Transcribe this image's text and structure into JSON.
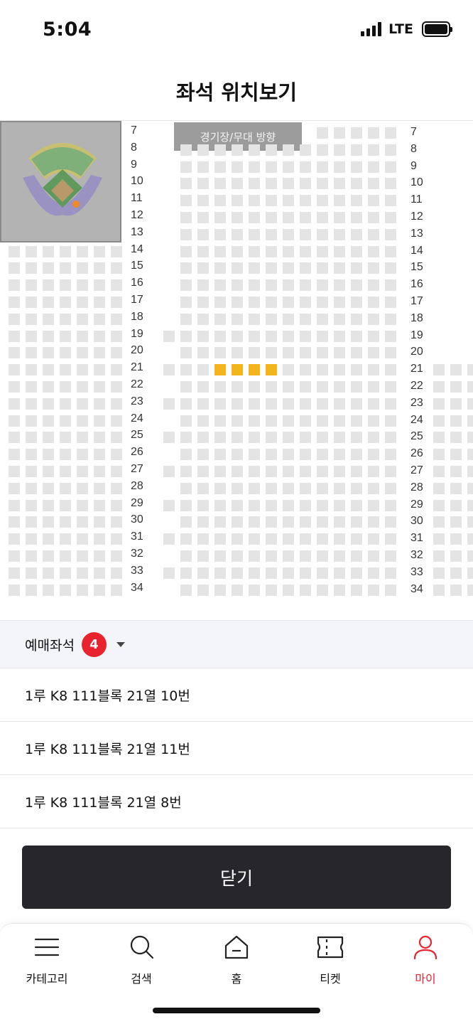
{
  "status_bar": {
    "time": "5:04",
    "network": "LTE",
    "battery_level": 1.0
  },
  "header": {
    "title": "좌석 위치보기"
  },
  "seat_map": {
    "direction_label": "경기장/무대 방향",
    "rows_left": [
      "7",
      "8",
      "9",
      "10",
      "11",
      "12",
      "13",
      "14",
      "15",
      "16",
      "17",
      "18",
      "19",
      "20",
      "21",
      "22",
      "23",
      "24",
      "25",
      "26",
      "27",
      "28",
      "29",
      "30",
      "31",
      "32",
      "33",
      "34"
    ],
    "rows_right": [
      "7",
      "8",
      "9",
      "10",
      "11",
      "12",
      "13",
      "14",
      "15",
      "16",
      "17",
      "18",
      "19",
      "20",
      "21",
      "22",
      "23",
      "24",
      "25",
      "26",
      "27",
      "28",
      "29",
      "30",
      "31",
      "32",
      "33",
      "34"
    ],
    "selected_row": "21",
    "seat_available_color": "#e4e4e4",
    "seat_selected_color": "#f3b51c",
    "minimap_icon": "stadium-minimap-icon"
  },
  "booked_seats": {
    "title": "예매좌석",
    "count": "4",
    "items": [
      {
        "text": "1루 K8 111블록 21열 10번"
      },
      {
        "text": "1루 K8 111블록 21열 11번"
      },
      {
        "text": "1루 K8 111블록 21열 8번"
      }
    ]
  },
  "close_button": {
    "label": "닫기"
  },
  "bottom_nav": {
    "items": [
      {
        "label": "카테고리",
        "icon": "menu-icon",
        "active": false
      },
      {
        "label": "검색",
        "icon": "search-icon",
        "active": false
      },
      {
        "label": "홈",
        "icon": "home-icon",
        "active": false
      },
      {
        "label": "티켓",
        "icon": "ticket-icon",
        "active": false
      },
      {
        "label": "마이",
        "icon": "user-icon",
        "active": true
      }
    ],
    "active_color": "#e8232e"
  }
}
